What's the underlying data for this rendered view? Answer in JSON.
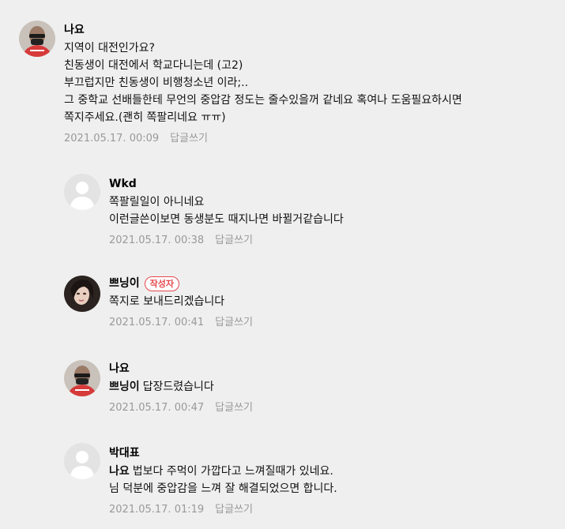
{
  "comments": [
    {
      "author": "나요",
      "lines": [
        "지역이 대전인가요?",
        "친동생이 대전에서 학교다니는데 (고2)",
        "부끄럽지만 친동생이 비행청소년 이라;..",
        "그 중학교 선배들한테 무언의 중압감 정도는 줄수있을꺼 같네요 혹여나 도움필요하시면",
        "쪽지주세요.(괜히 쪽팔리네요 ㅠㅠ)"
      ],
      "date": "2021.05.17. 00:09",
      "reply": "답글쓰기"
    },
    {
      "author": "Wkd",
      "lines": [
        "쪽팔릴일이 아니네요",
        "이런글쓴이보면 동생분도 때지나면 바뀔거같습니다"
      ],
      "date": "2021.05.17. 00:38",
      "reply": "답글쓰기"
    },
    {
      "author": "쁘닝이",
      "badge": "작성자",
      "lines": [
        "쪽지로 보내드리겠습니다"
      ],
      "date": "2021.05.17. 00:41",
      "reply": "답글쓰기"
    },
    {
      "author": "나요",
      "mention": "쁘닝이",
      "lines": [
        "답장드렸습니다"
      ],
      "date": "2021.05.17. 00:47",
      "reply": "답글쓰기"
    },
    {
      "author": "박대표",
      "mention": "나요",
      "lines": [
        "법보다 주먹이 가깝다고 느껴질때가 있네요.",
        "님 덕분에 중압감을 느껴 잘 해결되었으면 합니다."
      ],
      "date": "2021.05.17. 01:19",
      "reply": "답글쓰기"
    }
  ]
}
